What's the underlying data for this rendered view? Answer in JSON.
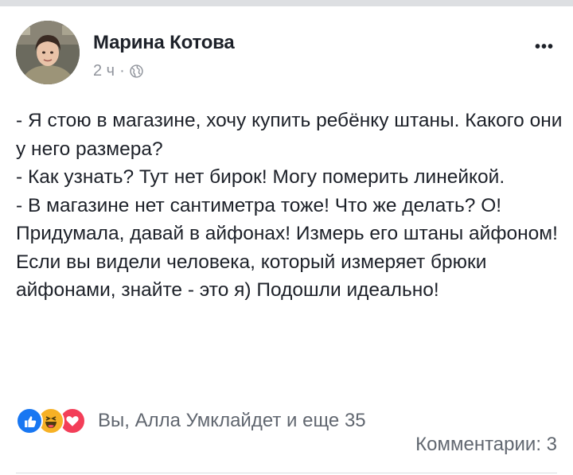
{
  "post": {
    "author": "Марина Котова",
    "time": "2 ч",
    "separator": "·",
    "privacy_icon": "globe-icon",
    "menu_icon": "more-options-icon",
    "menu_glyph": "•••",
    "lines": [
      "- Я стою в магазине, хочу купить ребёнку штаны. Какого они у него размера?",
      "- Как узнать? Тут нет бирок! Могу померить линейкой.",
      "- В магазине нет сантиметра тоже! Что же делать? О! Придумала, давай в айфонах! Измерь его штаны айфоном!",
      "Если вы видели человека, который измеряет брюки айфонами, знайте - это я) Подошли идеально!"
    ]
  },
  "reactions": {
    "icons": [
      "like-icon",
      "haha-icon",
      "love-icon"
    ],
    "summary": "Вы, Алла Умклайдет и еще 35",
    "comments": "Комментарии: 3"
  },
  "colors": {
    "text": "#1d2129",
    "secondary": "#90949c",
    "like": "#1877f2",
    "haha": "#f7b125",
    "love": "#f33e58"
  }
}
